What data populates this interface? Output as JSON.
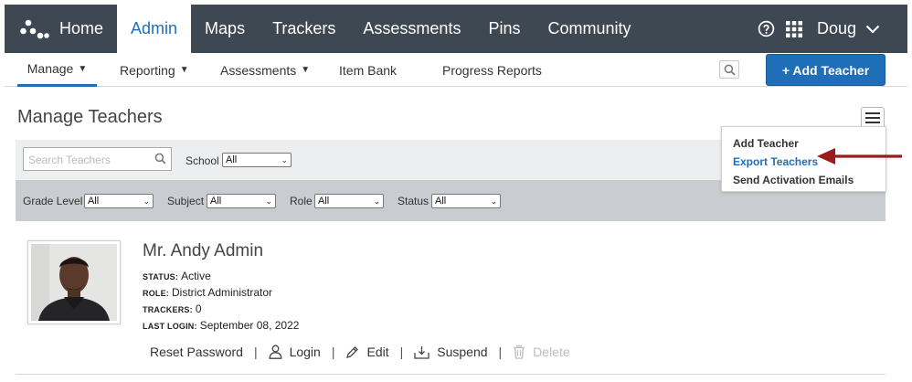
{
  "topnav": {
    "home": "Home",
    "admin": "Admin",
    "maps": "Maps",
    "trackers": "Trackers",
    "assessments": "Assessments",
    "pins": "Pins",
    "community": "Community",
    "user": "Doug"
  },
  "subnav": {
    "manage": "Manage",
    "reporting": "Reporting",
    "assessments": "Assessments",
    "item_bank": "Item Bank",
    "progress_reports": "Progress Reports",
    "add_teacher": "+ Add Teacher"
  },
  "page": {
    "title": "Manage Teachers"
  },
  "filters": {
    "search_placeholder": "Search Teachers",
    "school_label": "School",
    "school_value": "All",
    "grade_label": "Grade Level",
    "grade_value": "All",
    "subject_label": "Subject",
    "subject_value": "All",
    "role_label": "Role",
    "role_value": "All",
    "status_label": "Status",
    "status_value": "All"
  },
  "dropdown": {
    "items": [
      "Add Teacher",
      "Export Teachers",
      "Send Activation Emails"
    ]
  },
  "teacher": {
    "name": "Mr. Andy Admin",
    "status_key": "Status:",
    "status": "Active",
    "role_key": "Role:",
    "role": "District Administrator",
    "trackers_key": "Trackers:",
    "trackers": "0",
    "last_login_key": "Last Login:",
    "last_login": "September 08, 2022"
  },
  "actions": {
    "reset_password": "Reset Password",
    "login": "Login",
    "edit": "Edit",
    "suspend": "Suspend",
    "delete": "Delete"
  },
  "colors": {
    "nav_bg": "#3d4853",
    "accent": "#1f6fb8",
    "annotation_arrow": "#9b1c1c"
  }
}
